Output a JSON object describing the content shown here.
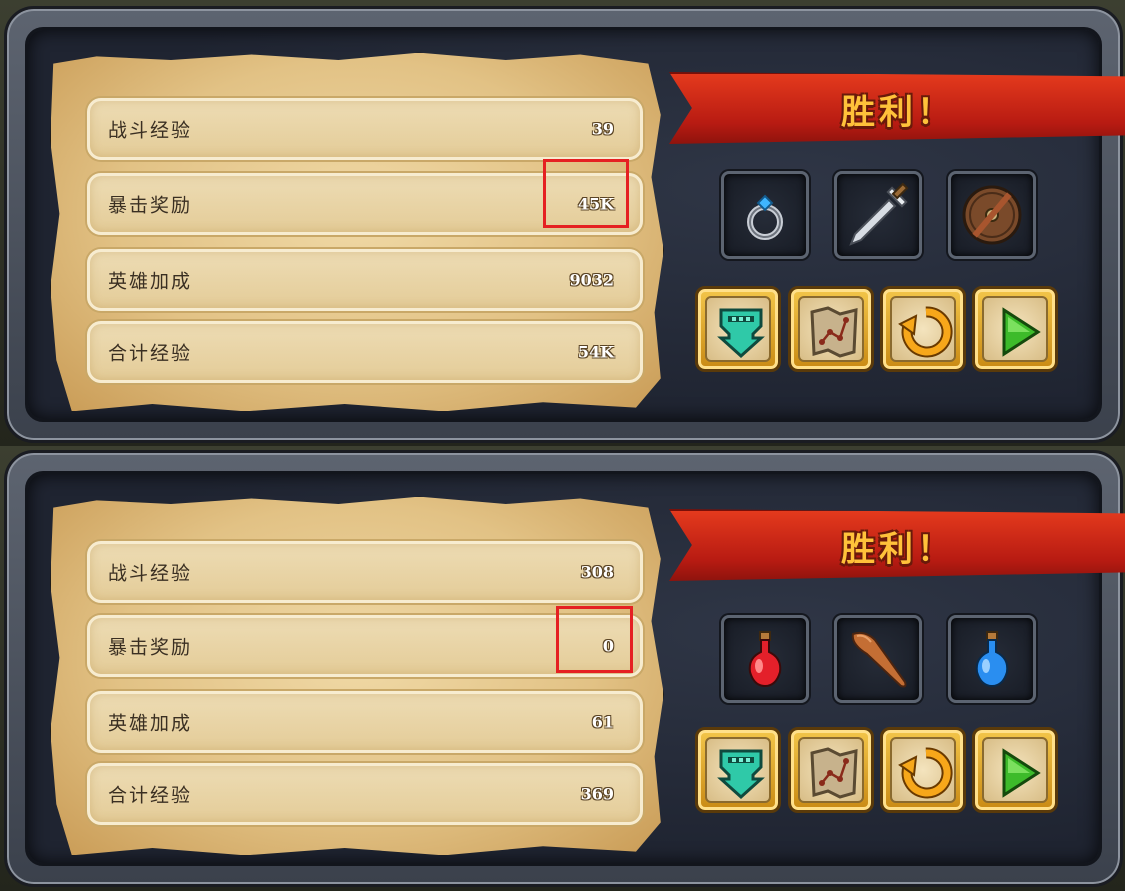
{
  "screens": [
    {
      "banner": "胜利！",
      "rows": [
        {
          "label": "战斗经验",
          "value": "39"
        },
        {
          "label": "暴击奖励",
          "value": "45K"
        },
        {
          "label": "英雄加成",
          "value": "9032"
        },
        {
          "label": "合计经验",
          "value": "54K"
        }
      ],
      "items": [
        "ring-icon",
        "sword-icon",
        "shield-icon"
      ],
      "highlight_row": 1
    },
    {
      "banner": "胜利！",
      "rows": [
        {
          "label": "战斗经验",
          "value": "308"
        },
        {
          "label": "暴击奖励",
          "value": "0"
        },
        {
          "label": "英雄加成",
          "value": "61"
        },
        {
          "label": "合计经验",
          "value": "369"
        }
      ],
      "items": [
        "red-potion-icon",
        "wooden-club-icon",
        "blue-potion-icon"
      ],
      "highlight_row": 1
    }
  ],
  "buttons": [
    "collect-down-icon",
    "map-icon",
    "retry-icon",
    "play-icon"
  ],
  "colors": {
    "banner": "#c8221a",
    "banner_text": "#ffc23a",
    "highlight": "#e52022",
    "parchment": "#e8cd94"
  }
}
